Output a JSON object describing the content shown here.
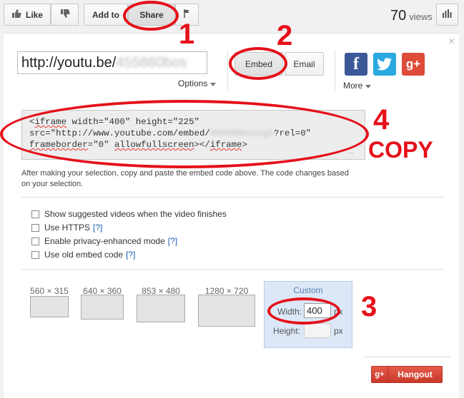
{
  "toolbar": {
    "like_label": "Like",
    "add_to_label": "Add to",
    "share_label": "Share",
    "views_count": "70",
    "views_label": "views"
  },
  "share": {
    "url_visible": "http://youtu.be/",
    "url_hidden": "455880bos",
    "options_label": "Options",
    "embed_label": "Embed",
    "email_label": "Email",
    "more_label": "More",
    "close_label": "×"
  },
  "embed": {
    "code_line1_pre": "<",
    "code_line1_a": "iframe",
    "code_line1_b": " width=\"400\" height=\"225\"",
    "code_line2_pre": "src=\"http://www.youtube.com/embed/",
    "code_line2_hidden": "455880boxsgk",
    "code_line2_post": "?rel=0\"",
    "code_line3_a": "frameborder",
    "code_line3_b": "=\"0\" ",
    "code_line3_c": "allowfullscreen",
    "code_line3_d": "></",
    "code_line3_e": "iframe",
    "code_line3_f": ">",
    "code_ellipsis": "..",
    "help_text": "After making your selection, copy and paste the embed code above. The code changes based on your selection."
  },
  "checkboxes": [
    {
      "label": "Show suggested videos when the video finishes",
      "help": ""
    },
    {
      "label": "Use HTTPS",
      "help": "[?]"
    },
    {
      "label": "Enable privacy-enhanced mode",
      "help": "[?]"
    },
    {
      "label": "Use old embed code",
      "help": "[?]"
    }
  ],
  "sizes": {
    "s1": "560 × 315",
    "s2": "640 × 360",
    "s3": "853 × 480",
    "s4": "1280 × 720",
    "custom_title": "Custom",
    "width_label": "Width:",
    "width_value": "400",
    "height_label": "Height:",
    "height_value": "",
    "px_label": "px"
  },
  "hangout_label": "Hangout",
  "annotations": {
    "n1": "1",
    "n2": "2",
    "n3": "3",
    "n4": "4",
    "copy": "COPY"
  },
  "colors": {
    "annotation_red": "#e5101a",
    "facebook": "#3b5998",
    "twitter": "#2aa9e0",
    "google_plus": "#dd4b39",
    "hangout": "#dd4b39",
    "custom_panel": "#dce8f8"
  }
}
